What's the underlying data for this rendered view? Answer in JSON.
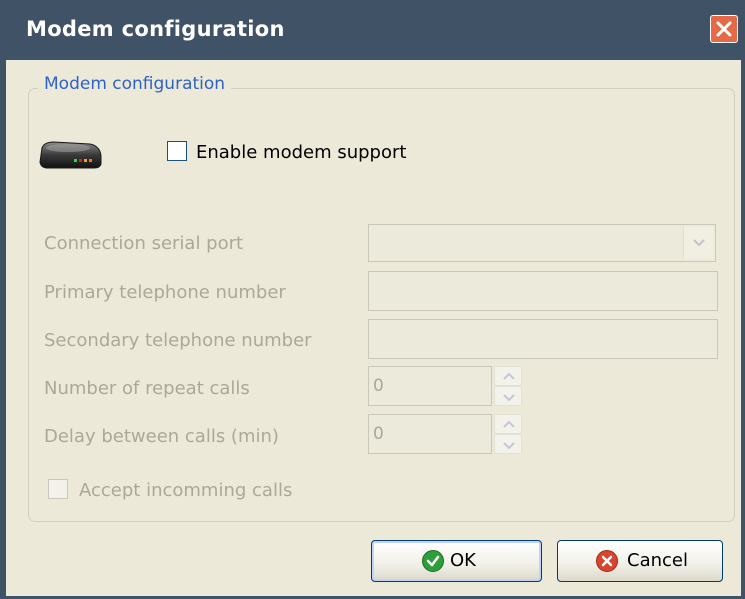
{
  "window": {
    "title": "Modem configuration"
  },
  "group": {
    "title": "Modem configuration"
  },
  "enable_modem": {
    "label": "Enable modem support",
    "checked": false
  },
  "fields": {
    "serial_port_label": "Connection serial port",
    "serial_port_value": "",
    "primary_phone_label": "Primary telephone number",
    "primary_phone_value": "",
    "secondary_phone_label": "Secondary telephone number",
    "secondary_phone_value": "",
    "repeat_calls_label": "Number of repeat calls",
    "repeat_calls_value": "0",
    "delay_label": "Delay between calls (min)",
    "delay_value": "0"
  },
  "accept_calls": {
    "label": "Accept incomming calls",
    "checked": false
  },
  "buttons": {
    "ok_label": "OK",
    "cancel_label": "Cancel"
  },
  "colors": {
    "titlebar": "#405266",
    "client_bg": "#ece9d8",
    "group_title": "#2f62c6",
    "disabled_text": "#aca899"
  }
}
